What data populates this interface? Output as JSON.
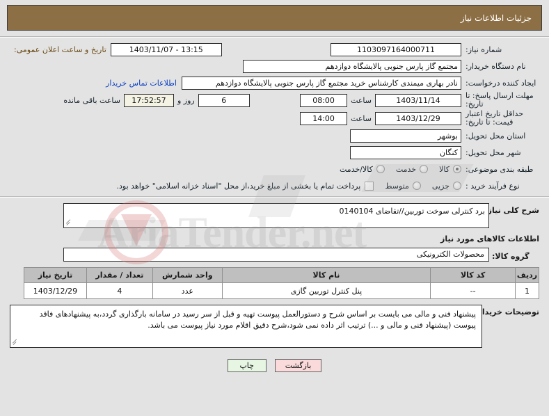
{
  "header": {
    "title": "جزئیات اطلاعات نیاز"
  },
  "colors": {
    "header_bg": "#8d6f45",
    "page_bg": "#e3e3e3",
    "link": "#0b3fc4",
    "publish_label": "#6b4b16",
    "table_header_bg": "#bfbfbf",
    "timer_bg": "#f4f3e4",
    "print_button_bg": "#e7f6e3",
    "back_button_bg": "#fadadb"
  },
  "form": {
    "need_number_label": "شماره نیاز:",
    "need_number_value": "1103097164000711",
    "publish_label": "تاریخ و ساعت اعلان عمومی:",
    "publish_value": "1403/11/07 - 13:15",
    "buyer_org_label": "نام دستگاه خریدار:",
    "buyer_org_value": "مجتمع گاز پارس جنوبی  پالایشگاه دوازدهم",
    "creator_label": "ایجاد کننده درخواست:",
    "creator_value": "نادر بهاری میمندی کارشناس خرید مجتمع گاز پارس جنوبی  پالایشگاه دوازدهم",
    "contact_link": "اطلاعات تماس خریدار",
    "response_deadline_label": "مهلت ارسال پاسخ: تا تاریخ:",
    "response_deadline_date": "1403/11/14",
    "response_deadline_hour_label": "ساعت",
    "response_deadline_hour": "08:00",
    "remaining_days": "6",
    "remaining_days_label": "روز و",
    "remaining_timer": "17:52:57",
    "remaining_suffix": "ساعت باقی مانده",
    "price_validity_label": "حداقل تاریخ اعتبار قیمت: تا تاریخ:",
    "price_validity_date": "1403/12/29",
    "price_validity_hour_label": "ساعت",
    "price_validity_hour": "14:00",
    "province_label": "استان محل تحویل:",
    "province_value": "بوشهر",
    "city_label": "شهر محل تحویل:",
    "city_value": "کنگان",
    "category_label": "طبقه بندی موضوعی:",
    "category_options": [
      {
        "label": "کالا",
        "selected": true
      },
      {
        "label": "خدمت",
        "selected": false
      },
      {
        "label": "کالا/خدمت",
        "selected": false
      }
    ],
    "process_label": "نوع فرآیند خرید :",
    "process_options": [
      {
        "label": "جزیی",
        "selected": false
      },
      {
        "label": "متوسط",
        "selected": false
      }
    ],
    "treasury_checkbox_text": "پرداخت تمام یا بخشی از مبلغ خرید،از محل \"اسناد خزانه اسلامی\" خواهد بود.",
    "treasury_checked": false
  },
  "description": {
    "label": "شرح کلی نیاز:",
    "value": "برد کنترلی سوخت توربین//تقاضای 0140104"
  },
  "goods": {
    "section_title": "اطلاعات کالاهای مورد نیاز",
    "group_label": "گروه کالا:",
    "group_value": "محصولات الکترونیکی",
    "table": {
      "columns": [
        "ردیف",
        "کد کالا",
        "نام کالا",
        "واحد شمارش",
        "تعداد / مقدار",
        "تاریخ نیاز"
      ],
      "rows": [
        {
          "radif": "1",
          "code": "--",
          "name": "پنل کنترل توربین گازی",
          "unit": "عدد",
          "quantity": "4",
          "date": "1403/12/29"
        }
      ]
    }
  },
  "notes": {
    "label": "توضیحات خریدار:",
    "value": "پیشنهاد فنی و مالی می بایست بر اساس شرح و دستورالعمل پیوست تهیه و قبل از سر رسید در سامانه بارگذاری گردد،به پیشنهادهای فاقد پیوست (پیشنهاد فنی و مالی و ...) ترتیب اثر داده نمی شود،شرح دقیق اقلام مورد نیاز پیوست می باشد."
  },
  "footer": {
    "print_label": "چاپ",
    "back_label": "بازگشت"
  },
  "watermark": {
    "text": "AriaTender.net"
  }
}
